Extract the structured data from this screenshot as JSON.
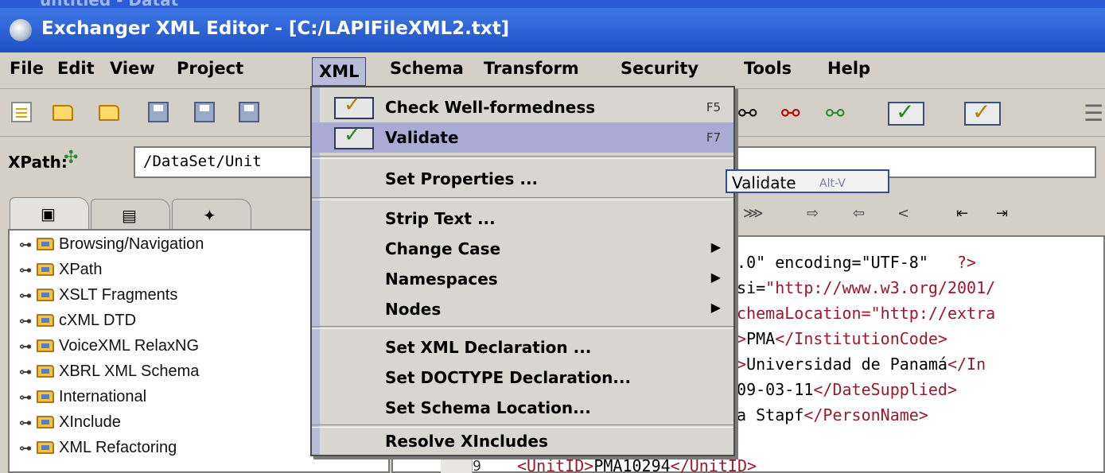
{
  "window": {
    "ghost_title": "untitled - Datat",
    "title": "Exchanger XML Editor - [C:/LAPIFileXML2.txt]"
  },
  "menubar": [
    "File",
    "Edit",
    "View",
    "Project",
    "XML",
    "Schema",
    "Transform",
    "Security",
    "Tools",
    "Help"
  ],
  "xpath": {
    "label": "XPath:",
    "value": "/DataSet/Unit"
  },
  "tree": [
    "Browsing/Navigation",
    "XPath",
    "XSLT Fragments",
    "cXML DTD",
    "VoiceXML RelaxNG",
    "XBRL XML Schema",
    "International",
    "XInclude",
    "XML Refactoring"
  ],
  "xml_menu": {
    "check": {
      "label": "Check Well-formedness",
      "shortcut": "F5"
    },
    "validate": {
      "label": "Validate",
      "shortcut": "F7"
    },
    "set_properties": "Set Properties ...",
    "strip_text": "Strip Text ...",
    "change_case": "Change Case",
    "namespaces": "Namespaces",
    "nodes": "Nodes",
    "set_xml_decl": "Set XML Declaration ...",
    "set_doctype": "Set DOCTYPE Declaration...",
    "set_schema_loc": "Set Schema Location...",
    "resolve_xincludes": "Resolve XIncludes"
  },
  "tooltip": {
    "text": "Validate",
    "accelerator": "Alt-V"
  },
  "code": {
    "line1": {
      "a": "1.0\" encoding=\"UTF-8\"",
      "b": "?>"
    },
    "line2": {
      "a": "xsi=",
      "b": "\"http://www.w3.org/2001/"
    },
    "line3": {
      "a": "SchemaLocation=\"http://extra"
    },
    "line4": {
      "a": "e>",
      "b": "PMA",
      "c": "</InstitutionCode>"
    },
    "line5": {
      "a": "e>",
      "b": "Universidad de Panamá",
      "c": "</In"
    },
    "line6": {
      "a": "009-03-11",
      "b": "</DateSupplied>"
    },
    "line7": {
      "a": "ía Stapf",
      "b": "</PersonName>"
    },
    "line9": {
      "num": "9",
      "a": "<UnitID>",
      "b": "PMA10294",
      "c": "</UnitID>"
    }
  }
}
